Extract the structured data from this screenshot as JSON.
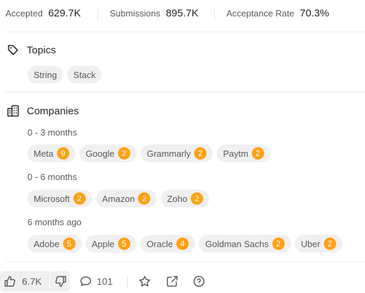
{
  "stats": [
    {
      "label": "Accepted",
      "value": "629.7K"
    },
    {
      "label": "Submissions",
      "value": "895.7K"
    },
    {
      "label": "Acceptance Rate",
      "value": "70.3%"
    }
  ],
  "topics": {
    "title": "Topics",
    "icon": "tag-icon",
    "items": [
      "String",
      "Stack"
    ]
  },
  "companies": {
    "title": "Companies",
    "icon": "building-icon",
    "groups": [
      {
        "period": "0 - 3 months",
        "items": [
          {
            "name": "Meta",
            "count": "9"
          },
          {
            "name": "Google",
            "count": "2"
          },
          {
            "name": "Grammarly",
            "count": "2"
          },
          {
            "name": "Paytm",
            "count": "2"
          }
        ]
      },
      {
        "period": "0 - 6 months",
        "items": [
          {
            "name": "Microsoft",
            "count": "2"
          },
          {
            "name": "Amazon",
            "count": "2"
          },
          {
            "name": "Zoho",
            "count": "2"
          }
        ]
      },
      {
        "period": "6 months ago",
        "items": [
          {
            "name": "Adobe",
            "count": "5"
          },
          {
            "name": "Apple",
            "count": "5"
          },
          {
            "name": "Oracle",
            "count": "4"
          },
          {
            "name": "Goldman Sachs",
            "count": "2"
          },
          {
            "name": "Uber",
            "count": "2"
          }
        ]
      }
    ]
  },
  "footer": {
    "upvotes": "6.7K",
    "comments": "101",
    "icons": [
      "thumbs-up-icon",
      "thumbs-down-icon",
      "comment-icon",
      "star-icon",
      "share-icon",
      "help-icon"
    ]
  },
  "colors": {
    "badge": "#ffa116",
    "chip": "#f0f0f0",
    "text": "#262626",
    "muted": "#595959"
  }
}
